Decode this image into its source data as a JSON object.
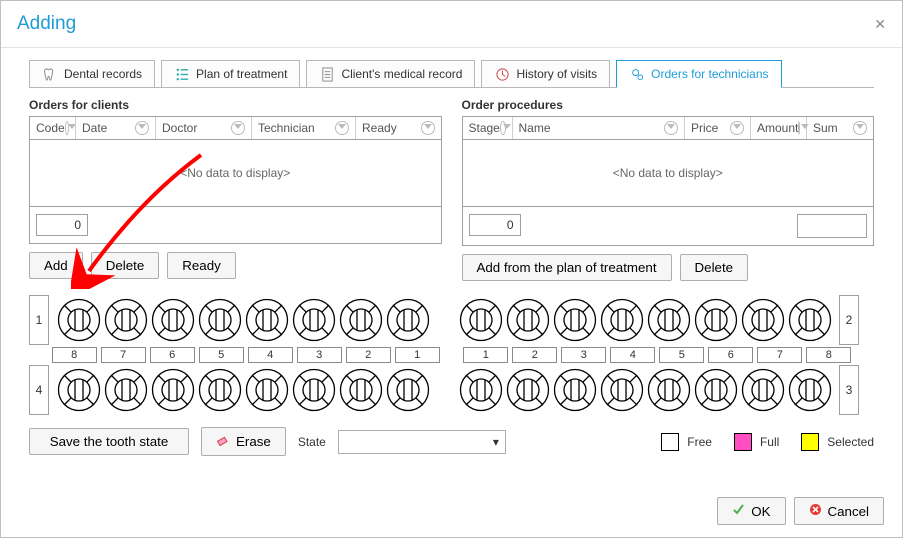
{
  "dialog": {
    "title": "Adding"
  },
  "tabs": [
    {
      "label": "Dental records"
    },
    {
      "label": "Plan of treatment"
    },
    {
      "label": "Client's medical record"
    },
    {
      "label": "History of visits"
    },
    {
      "label": "Orders for technicians"
    }
  ],
  "ordersClients": {
    "title": "Orders for clients",
    "columns": [
      "Code",
      "Date",
      "Doctor",
      "Technician",
      "Ready"
    ],
    "empty": "<No data to display>",
    "sum": "0",
    "buttons": {
      "add": "Add",
      "delete": "Delete",
      "ready": "Ready"
    }
  },
  "orderProcedures": {
    "title": "Order procedures",
    "columns": [
      "Stage",
      "Name",
      "Price",
      "Amount",
      "Sum"
    ],
    "empty": "<No data to display>",
    "sum": "0",
    "buttons": {
      "addFromPlan": "Add from the plan of treatment",
      "delete": "Delete"
    }
  },
  "teeth": {
    "sideLabels": {
      "topLeft": "1",
      "topRight": "2",
      "bottomLeft": "4",
      "bottomRight": "3"
    },
    "numbersLeft": [
      "8",
      "7",
      "6",
      "5",
      "4",
      "3",
      "2",
      "1"
    ],
    "numbersRight": [
      "1",
      "2",
      "3",
      "4",
      "5",
      "6",
      "7",
      "8"
    ]
  },
  "footer": {
    "saveTooth": "Save the tooth state",
    "erase": "Erase",
    "stateLabel": "State",
    "legend": {
      "free": "Free",
      "full": "Full",
      "selected": "Selected"
    },
    "colors": {
      "free": "#ffffff",
      "full": "#ff4fc3",
      "selected": "#ffff00"
    }
  },
  "dialogButtons": {
    "ok": "OK",
    "cancel": "Cancel"
  }
}
